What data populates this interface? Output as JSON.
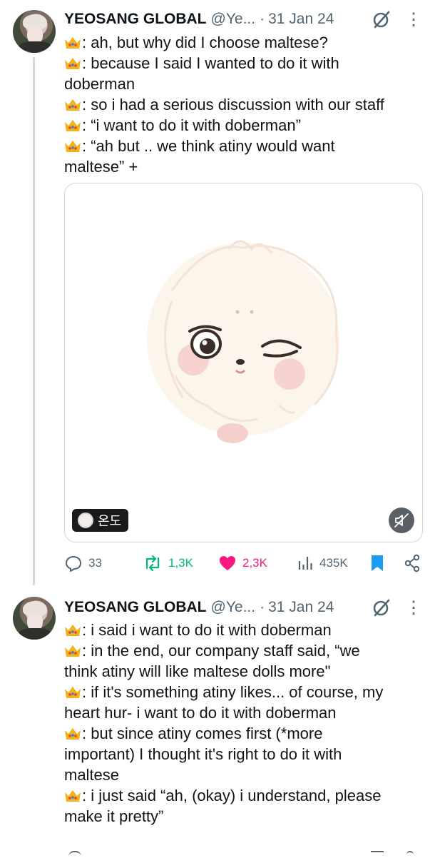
{
  "tweets": [
    {
      "author": {
        "name": "YEOSANG GLOBAL",
        "handle": "@Ye...",
        "date": "31 Jan 24"
      },
      "lines": [
        ": ah, but why did I choose maltese?",
        ": because I said I wanted to do it with",
        "doberman",
        ": so i had a serious discussion with our staff",
        ": “i want to do it with doberman”",
        ": “ah but .. we think atiny would want",
        "maltese” +"
      ],
      "media": {
        "badge_label": "온도"
      },
      "actions": {
        "replies": "33",
        "retweets": "1,3K",
        "likes": "2,3K",
        "views": "435K"
      }
    },
    {
      "author": {
        "name": "YEOSANG GLOBAL",
        "handle": "@Ye...",
        "date": "31 Jan 24"
      },
      "lines": [
        ": i said i want to do it with doberman",
        ": in the end, our company staff said, “we",
        "think atiny will like maltese dolls more\"",
        ": if it's something atiny likes... of course, my",
        "heart hur- i want to do it with doberman",
        ": but since atiny comes first (*more",
        "important) I thought it's right to do  it with",
        "maltese",
        ": i just said “ah, (okay) i understand, please",
        "make it pretty”"
      ]
    }
  ],
  "icons": {
    "crown": "crown-emoji",
    "grok": "grok-icon",
    "more": "more-icon",
    "reply": "reply-icon",
    "retweet": "retweet-icon",
    "like": "heart-icon",
    "views": "views-icon",
    "bookmark": "bookmark-icon",
    "share": "share-icon",
    "mute": "muted-speaker-icon"
  },
  "colors": {
    "text": "#0f1419",
    "secondary": "#536471",
    "retweet": "#00ba7c",
    "like": "#f91880",
    "bookmark": "#1d9bf0",
    "thread_line": "#cfd9de"
  }
}
